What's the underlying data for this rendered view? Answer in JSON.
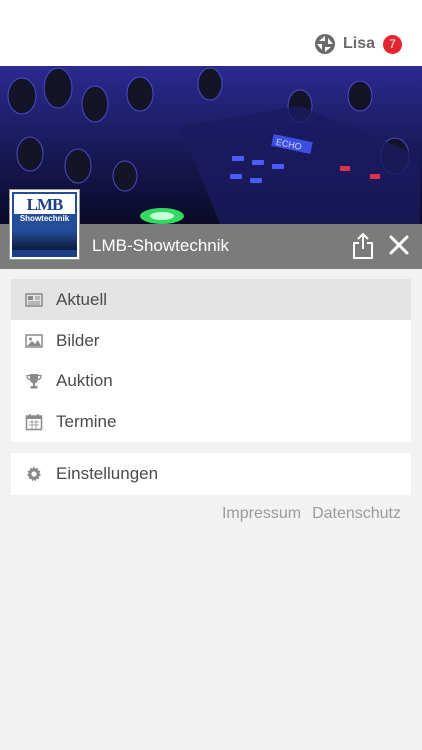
{
  "header": {
    "user_name": "Lisa",
    "notification_count": "7",
    "badge_color": "#e3262d"
  },
  "hero": {
    "image": "dj-mixer-photo",
    "display_text": "ECHO"
  },
  "group": {
    "title": "LMB-Showtechnik",
    "logo": {
      "mark": "LMB",
      "name": "Showtechnik"
    },
    "share_icon": "share-icon",
    "close_icon": "close-icon"
  },
  "menu": {
    "items": [
      {
        "label": "Aktuell",
        "icon": "newspaper-icon",
        "active": true
      },
      {
        "label": "Bilder",
        "icon": "image-icon",
        "active": false
      },
      {
        "label": "Auktion",
        "icon": "trophy-icon",
        "active": false
      },
      {
        "label": "Termine",
        "icon": "calendar-icon",
        "active": false
      }
    ],
    "settings": {
      "label": "Einstellungen",
      "icon": "gear-icon"
    }
  },
  "footer": {
    "impressum": "Impressum",
    "datenschutz": "Datenschutz"
  }
}
